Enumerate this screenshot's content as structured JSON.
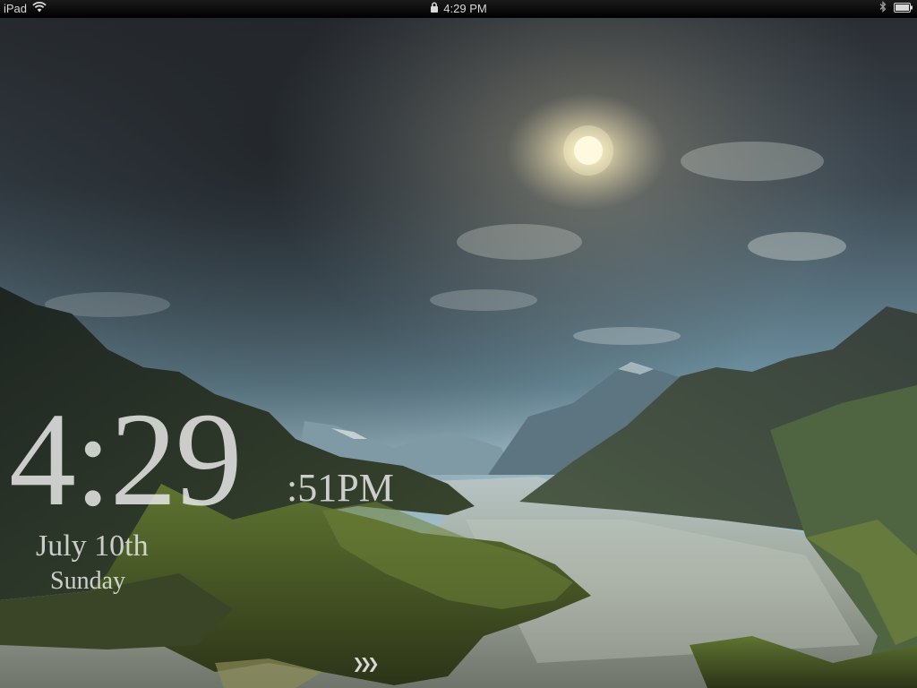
{
  "status_bar": {
    "device_label": "iPad",
    "time": "4:29 PM",
    "icons": [
      "wifi-icon",
      "lock-icon",
      "bluetooth-icon",
      "battery-icon"
    ]
  },
  "lock_screen": {
    "clock": {
      "hours_minutes": "4:29",
      "seconds_ampm": ":51PM"
    },
    "date": "July 10th",
    "day": "Sunday",
    "unlock_slider": {
      "icon": "triple-chevron-right-icon",
      "glyph": "❯❯❯"
    }
  },
  "colors": {
    "status_bar_bg": "#000000",
    "status_text": "#d8d8d8",
    "clock_text": "#e6e6e6"
  }
}
